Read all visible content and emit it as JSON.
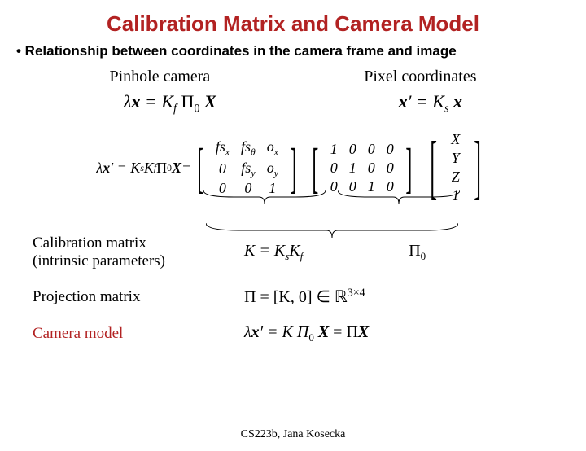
{
  "title": "Calibration Matrix and Camera Model",
  "bullet": "• Relationship between coordinates in the camera frame and image",
  "sub1": "Pinhole camera",
  "sub2": "Pixel coordinates",
  "eq1_lhs": "λ",
  "eq1_x": "x",
  "eq1_eq": " = K",
  "eq1_sub": "f",
  "eq1_pi": " Π",
  "eq1_zero": "0",
  "eq1_X": " X",
  "eq2_lhs": "x",
  "eq2_prime": "′",
  "eq2_eq": " = K",
  "eq2_sub": "s",
  "eq2_x": " x",
  "big_pre1": "λ",
  "big_pre2": "x",
  "big_pre3": "′ = K",
  "big_s": "s",
  "big_k": "K",
  "big_f": "f",
  "big_pi": " Π",
  "big_0": "0",
  "big_X": "X",
  "big_eq2": " = ",
  "m1_00": "fs",
  "m1_00s": "x",
  "m1_01": "fs",
  "m1_01s": "θ",
  "m1_02": "o",
  "m1_02s": "x",
  "m1_10": "0",
  "m1_11": "fs",
  "m1_11s": "y",
  "m1_12": "o",
  "m1_12s": "y",
  "m1_20": "0",
  "m1_21": "0",
  "m1_22": "1",
  "m2_00": "1",
  "m2_01": "0",
  "m2_02": "0",
  "m2_03": "0",
  "m2_10": "0",
  "m2_11": "1",
  "m2_12": "0",
  "m2_13": "0",
  "m2_20": "0",
  "m2_21": "0",
  "m2_22": "1",
  "m2_23": "0",
  "v_X": "X",
  "v_Y": "Y",
  "v_Z": "Z",
  "v_1": "1",
  "lab1a": "Calibration matrix",
  "lab1b": "(intrinsic parameters)",
  "lab1eq_K": "K = K",
  "lab1eq_s": "s",
  "lab1eq_K2": "K",
  "lab1eq_f": "f",
  "lab1_pi": "Π",
  "lab1_pi0": "0",
  "lab2": "Projection matrix",
  "lab2eq": "Π = [K, 0] ∈ ℝ",
  "lab2sup": "3×4",
  "lab3": "Camera model",
  "lab3eq_l": "λ",
  "lab3eq_x": "x",
  "lab3eq_p": "′ = K Π",
  "lab3eq_0": "0",
  "lab3eq_X": " X",
  "lab3eq_eq2": " = Π",
  "lab3eq_X2": "X",
  "footer": "CS223b, Jana Kosecka"
}
